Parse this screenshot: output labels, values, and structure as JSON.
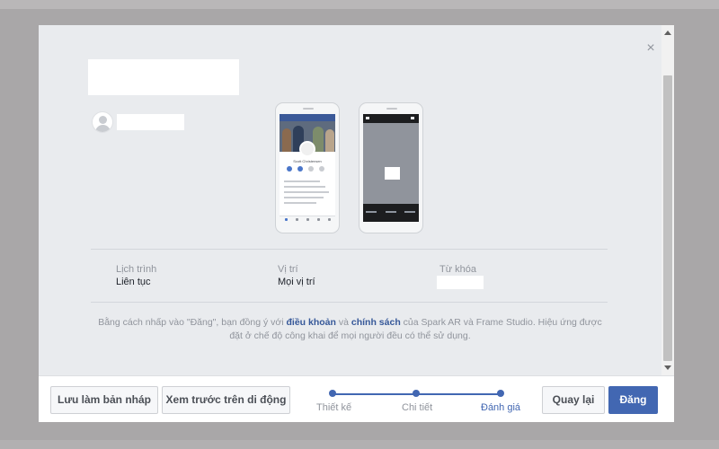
{
  "dialog": {
    "close_glyph": "×"
  },
  "preview": {
    "left_phone_profile_name": "Scott Christensen"
  },
  "meta": {
    "schedule_label": "Lịch trình",
    "schedule_value": "Liên tục",
    "location_label": "Vị trí",
    "location_value": "Mọi vị trí",
    "keywords_label": "Từ khóa"
  },
  "terms": {
    "part1": "Bằng cách nhấp vào \"Đăng\", bạn đồng ý với ",
    "link_terms": "điều khoản",
    "part2": " và ",
    "link_policy": "chính sách",
    "part3": " của Spark AR và Frame Studio. Hiệu ứng được đặt ở chế độ công khai để mọi người đều có thể sử dụng."
  },
  "footer": {
    "save_draft_label": "Lưu làm bản nháp",
    "preview_mobile_label": "Xem trước trên di động",
    "back_label": "Quay lại",
    "publish_label": "Đăng"
  },
  "steps": {
    "items": [
      {
        "label": "Thiết kế"
      },
      {
        "label": "Chi tiết"
      },
      {
        "label": "Đánh giá"
      }
    ],
    "active_index": 2
  },
  "colors": {
    "accent": "#4267b2",
    "link": "#365899",
    "overlay": "#a9a7a8"
  }
}
